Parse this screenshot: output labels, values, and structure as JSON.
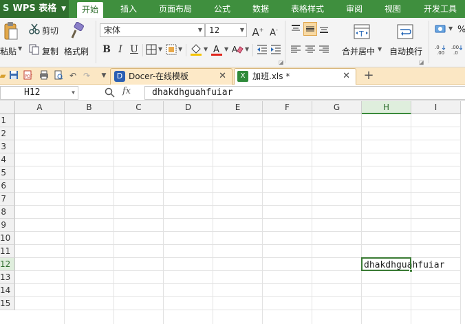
{
  "app": {
    "name": "WPS 表格"
  },
  "menu": [
    "开始",
    "插入",
    "页面布局",
    "公式",
    "数据",
    "表格样式",
    "审阅",
    "视图",
    "开发工具"
  ],
  "ribbon": {
    "paste": "粘贴",
    "cut": "剪切",
    "copy": "复制",
    "format_painter": "格式刷",
    "font_name": "宋体",
    "font_size": "12",
    "grow_font": "A",
    "shrink_font": "A",
    "bold": "B",
    "italic": "I",
    "underline": "U",
    "merge_center": "合并居中",
    "wrap_text": "自动换行",
    "percent": "%"
  },
  "tabs": [
    {
      "label": "Docer-在线模板"
    },
    {
      "label": "加班.xls *"
    }
  ],
  "formula_bar": {
    "name_box": "H12",
    "fx": "fx",
    "content": "dhakdhguahfuiar"
  },
  "grid": {
    "columns": [
      "A",
      "B",
      "C",
      "D",
      "E",
      "F",
      "G",
      "H",
      "I"
    ],
    "rows": [
      "1",
      "2",
      "3",
      "4",
      "5",
      "6",
      "7",
      "8",
      "9",
      "10",
      "11",
      "12",
      "13",
      "14",
      "15"
    ],
    "selected_column": "H",
    "selected_row": "12",
    "active_cell_value": "dhakdhguahfuiar"
  },
  "colors": {
    "menubar": "#3f8f3e",
    "active_border": "#3a7a34",
    "tabbar": "#fbe7c4"
  }
}
